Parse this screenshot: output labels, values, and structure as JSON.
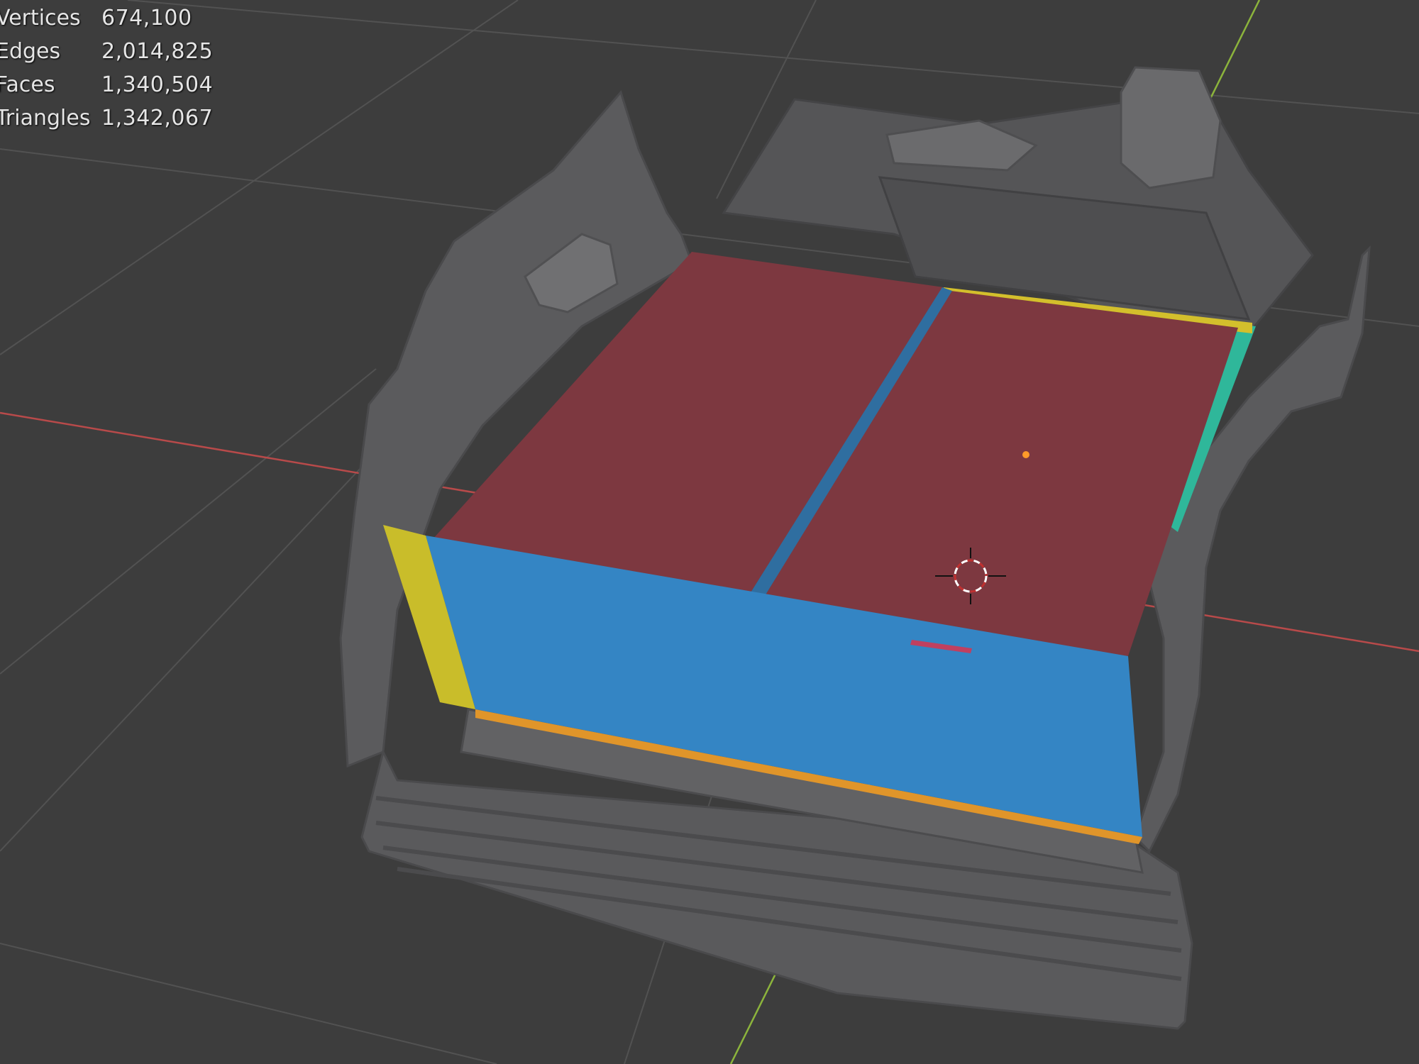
{
  "viewport": {
    "background": "#3d3d3d",
    "grid_color": "#525252",
    "x_axis_color": "#b84a4a",
    "y_axis_color": "#8cb43c"
  },
  "statistics": {
    "vertices": {
      "label": "Vertices",
      "value": "674,100"
    },
    "edges": {
      "label": "Edges",
      "value": "2,014,825"
    },
    "faces": {
      "label": "Faces",
      "value": "1,340,504"
    },
    "triangles": {
      "label": "Triangles",
      "value": "1,342,067"
    }
  },
  "scene": {
    "scan_color": "#5e5e60",
    "box_top_color": "#7d3840",
    "box_front_color": "#3485c4",
    "box_side_color": "#c9bd2a",
    "box_edge_color": "#e0952a",
    "box_teal_color": "#2fb79a",
    "origin_icon": "origin-dot-icon",
    "cursor_icon": "3d-cursor-icon"
  }
}
